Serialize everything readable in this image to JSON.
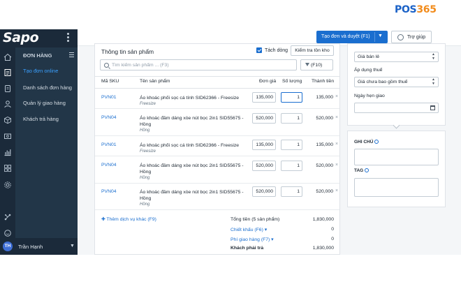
{
  "brand": {
    "prefix": "POS",
    "number": "365"
  },
  "app": {
    "logo": "Sapo"
  },
  "topbar": {
    "create_button": "Tạo đơn và duyệt (F1)",
    "help_button": "Trợ giúp"
  },
  "sidebar": {
    "section_title": "ĐƠN HÀNG",
    "items": [
      {
        "label": "Tạo đơn online",
        "active": true
      },
      {
        "label": "Danh sách đơn hàng",
        "active": false
      },
      {
        "label": "Quản lý giao hàng",
        "active": false
      },
      {
        "label": "Khách trả hàng",
        "active": false
      }
    ],
    "user": {
      "initials": "TH",
      "name": "Trần Hạnh"
    }
  },
  "products": {
    "title": "Thông tin sản phẩm",
    "split_lines_label": "Tách dòng",
    "split_lines_checked": true,
    "stock_button": "Kiểm tra tồn kho",
    "search_placeholder": "Tìm kiếm sản phẩm ... (F3)",
    "filter_button": "(F10)",
    "columns": {
      "sku": "Mã SKU",
      "name": "Tên sản phẩm",
      "price": "Đơn giá",
      "qty": "Số lượng",
      "total": "Thành tiền"
    },
    "rows": [
      {
        "sku": "PVN01",
        "name": "Áo khoác phối sọc cá tính SID62366 - Freesize",
        "variant": "Freesize",
        "price": "135,000",
        "qty": "1",
        "total": "135,000"
      },
      {
        "sku": "PVN04",
        "name": "Áo khoác đầm dáng xòe nút bọc 2in1 SID55675 - Hồng",
        "variant": "Hồng",
        "price": "520,000",
        "qty": "1",
        "total": "520,000"
      },
      {
        "sku": "PVN01",
        "name": "Áo khoác phối sọc cá tính SID62366 - Freesize",
        "variant": "Freesize",
        "price": "135,000",
        "qty": "1",
        "total": "135,000"
      },
      {
        "sku": "PVN04",
        "name": "Áo khoác đầm dáng xòe nút bọc 2in1 SID55675 - Hồng",
        "variant": "Hồng",
        "price": "520,000",
        "qty": "1",
        "total": "520,000"
      },
      {
        "sku": "PVN04",
        "name": "Áo khoác đầm dáng xòe nút bọc 2in1 SID55675 - Hồng",
        "variant": "Hồng",
        "price": "520,000",
        "qty": "1",
        "total": "520,000"
      }
    ],
    "add_service": "Thêm dịch vụ khác (F9)",
    "summary": {
      "subtotal_label": "Tổng tiền (5 sản phẩm)",
      "subtotal": "1,830,000",
      "discount_label": "Chiết khấu (F6)",
      "discount": "0",
      "shipping_label": "Phí giao hàng (F7)",
      "shipping": "0",
      "due_label": "Khách phải trả",
      "due": "1,830,000"
    }
  },
  "order_info": {
    "price_list": "Giá bán lẻ",
    "tax_label": "Áp dụng thuế",
    "tax_value": "Giá chưa bao gồm thuế",
    "delivery_label": "Ngày hẹn giao",
    "delivery_value": ""
  },
  "notes": {
    "note_label": "GHI CHÚ",
    "tag_label": "TAG",
    "note_value": "",
    "tag_value": ""
  }
}
